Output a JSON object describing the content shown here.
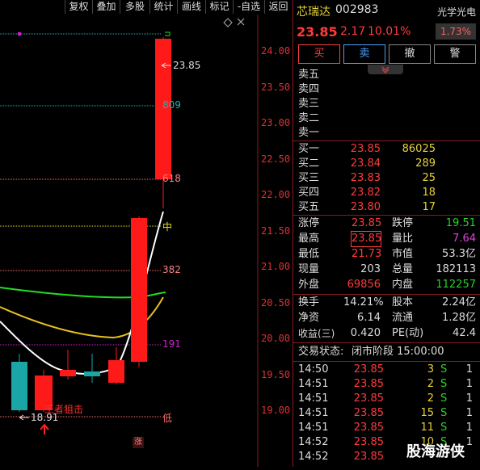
{
  "toolbar": {
    "buttons": [
      "复权",
      "叠加",
      "多股",
      "统计",
      "画线",
      "标记",
      "-自选",
      "返回"
    ]
  },
  "stock": {
    "name": "芯瑞达",
    "code": "002983",
    "price": "23.85",
    "change": "2.17",
    "change_pct": "10.01%",
    "sector": "光学光电",
    "sector_pct": "1.73%"
  },
  "trade_buttons": [
    "买",
    "卖",
    "撤",
    "警"
  ],
  "asks": [
    {
      "label": "卖五",
      "price": "",
      "vol": ""
    },
    {
      "label": "卖四",
      "price": "",
      "vol": ""
    },
    {
      "label": "卖三",
      "price": "",
      "vol": ""
    },
    {
      "label": "卖二",
      "price": "",
      "vol": ""
    },
    {
      "label": "卖一",
      "price": "",
      "vol": ""
    }
  ],
  "bids": [
    {
      "label": "买一",
      "price": "23.85",
      "vol": "86025"
    },
    {
      "label": "买二",
      "price": "23.84",
      "vol": "289"
    },
    {
      "label": "买三",
      "price": "23.83",
      "vol": "25"
    },
    {
      "label": "买四",
      "price": "23.82",
      "vol": "18"
    },
    {
      "label": "买五",
      "price": "23.80",
      "vol": "17"
    }
  ],
  "stats": {
    "limit_up_label": "涨停",
    "limit_up": "23.85",
    "limit_down_label": "跌停",
    "limit_down": "19.51",
    "high_label": "最高",
    "high": "23.85",
    "vol_ratio_label": "量比",
    "vol_ratio": "7.64",
    "low_label": "最低",
    "low": "21.73",
    "mkt_cap_label": "市值",
    "mkt_cap": "53.3亿",
    "cur_vol_label": "现量",
    "cur_vol": "203",
    "total_vol_label": "总量",
    "total_vol": "182113",
    "outer_label": "外盘",
    "outer": "69856",
    "inner_label": "内盘",
    "inner": "112257",
    "turnover_label": "换手",
    "turnover": "14.21%",
    "shares_label": "股本",
    "shares": "2.24亿",
    "nav_label": "净资",
    "nav": "6.14",
    "float_label": "流通",
    "float": "1.28亿",
    "eps_label": "收益(三)",
    "eps": "0.420",
    "pe_label": "PE(动)",
    "pe": "42.4"
  },
  "trade_status": {
    "label": "交易状态:",
    "value": "闭市阶段 15:00:00"
  },
  "ticks": [
    {
      "time": "14:50",
      "price": "23.85",
      "vol": "3",
      "side": "S",
      "n": "1"
    },
    {
      "time": "14:51",
      "price": "23.85",
      "vol": "2",
      "side": "S",
      "n": "1"
    },
    {
      "time": "14:51",
      "price": "23.85",
      "vol": "2",
      "side": "S",
      "n": "1"
    },
    {
      "time": "14:51",
      "price": "23.85",
      "vol": "15",
      "side": "S",
      "n": "1"
    },
    {
      "time": "14:51",
      "price": "23.85",
      "vol": "11",
      "side": "S",
      "n": "1"
    },
    {
      "time": "14:52",
      "price": "23.85",
      "vol": "10",
      "side": "S",
      "n": "1"
    },
    {
      "time": "14:52",
      "price": "23.85",
      "vol": "",
      "side": "",
      "n": ""
    }
  ],
  "watermark": "股海游侠",
  "chart": {
    "price_axis": [
      "24.00",
      "23.50",
      "23.00",
      "22.50",
      "22.00",
      "21.50",
      "21.00",
      "20.50",
      "20.00",
      "19.50",
      "19.00"
    ],
    "fib_labels": {
      "f809": "809",
      "f618": "618",
      "mid": "中",
      "f382": "382",
      "f191": "191",
      "low": "低"
    },
    "high_mark": "23.85",
    "low_mark": "18.91",
    "annotation": "王者狙击",
    "limit_badge": "涨",
    "colors": {
      "up": "#ff1a1a",
      "down": "#1aa6a6",
      "ma_green": "#22dd22",
      "ma_yellow": "#e6c020",
      "line_white": "#ffffff",
      "fib_cyan": "#20b0b0",
      "fib_pink": "#ff6a6a",
      "fib_yellow": "#e6e020",
      "fib_magenta": "#d020d0"
    }
  }
}
